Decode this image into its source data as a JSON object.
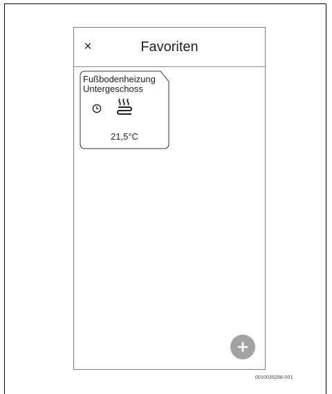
{
  "header": {
    "close_label": "×",
    "title": "Favoriten"
  },
  "favorites": [
    {
      "name_line1": "Fußbodenheizung",
      "name_line2": "Untergeschoss",
      "temperature": "21,5°C",
      "icons": [
        "clock-icon",
        "floor-heating-icon"
      ]
    }
  ],
  "fab": {
    "icon": "plus-icon"
  },
  "document_id": "0010035288-001",
  "colors": {
    "frame": "#000000",
    "phone_border": "#7a7a7a",
    "fab": "#a3a3a3"
  }
}
